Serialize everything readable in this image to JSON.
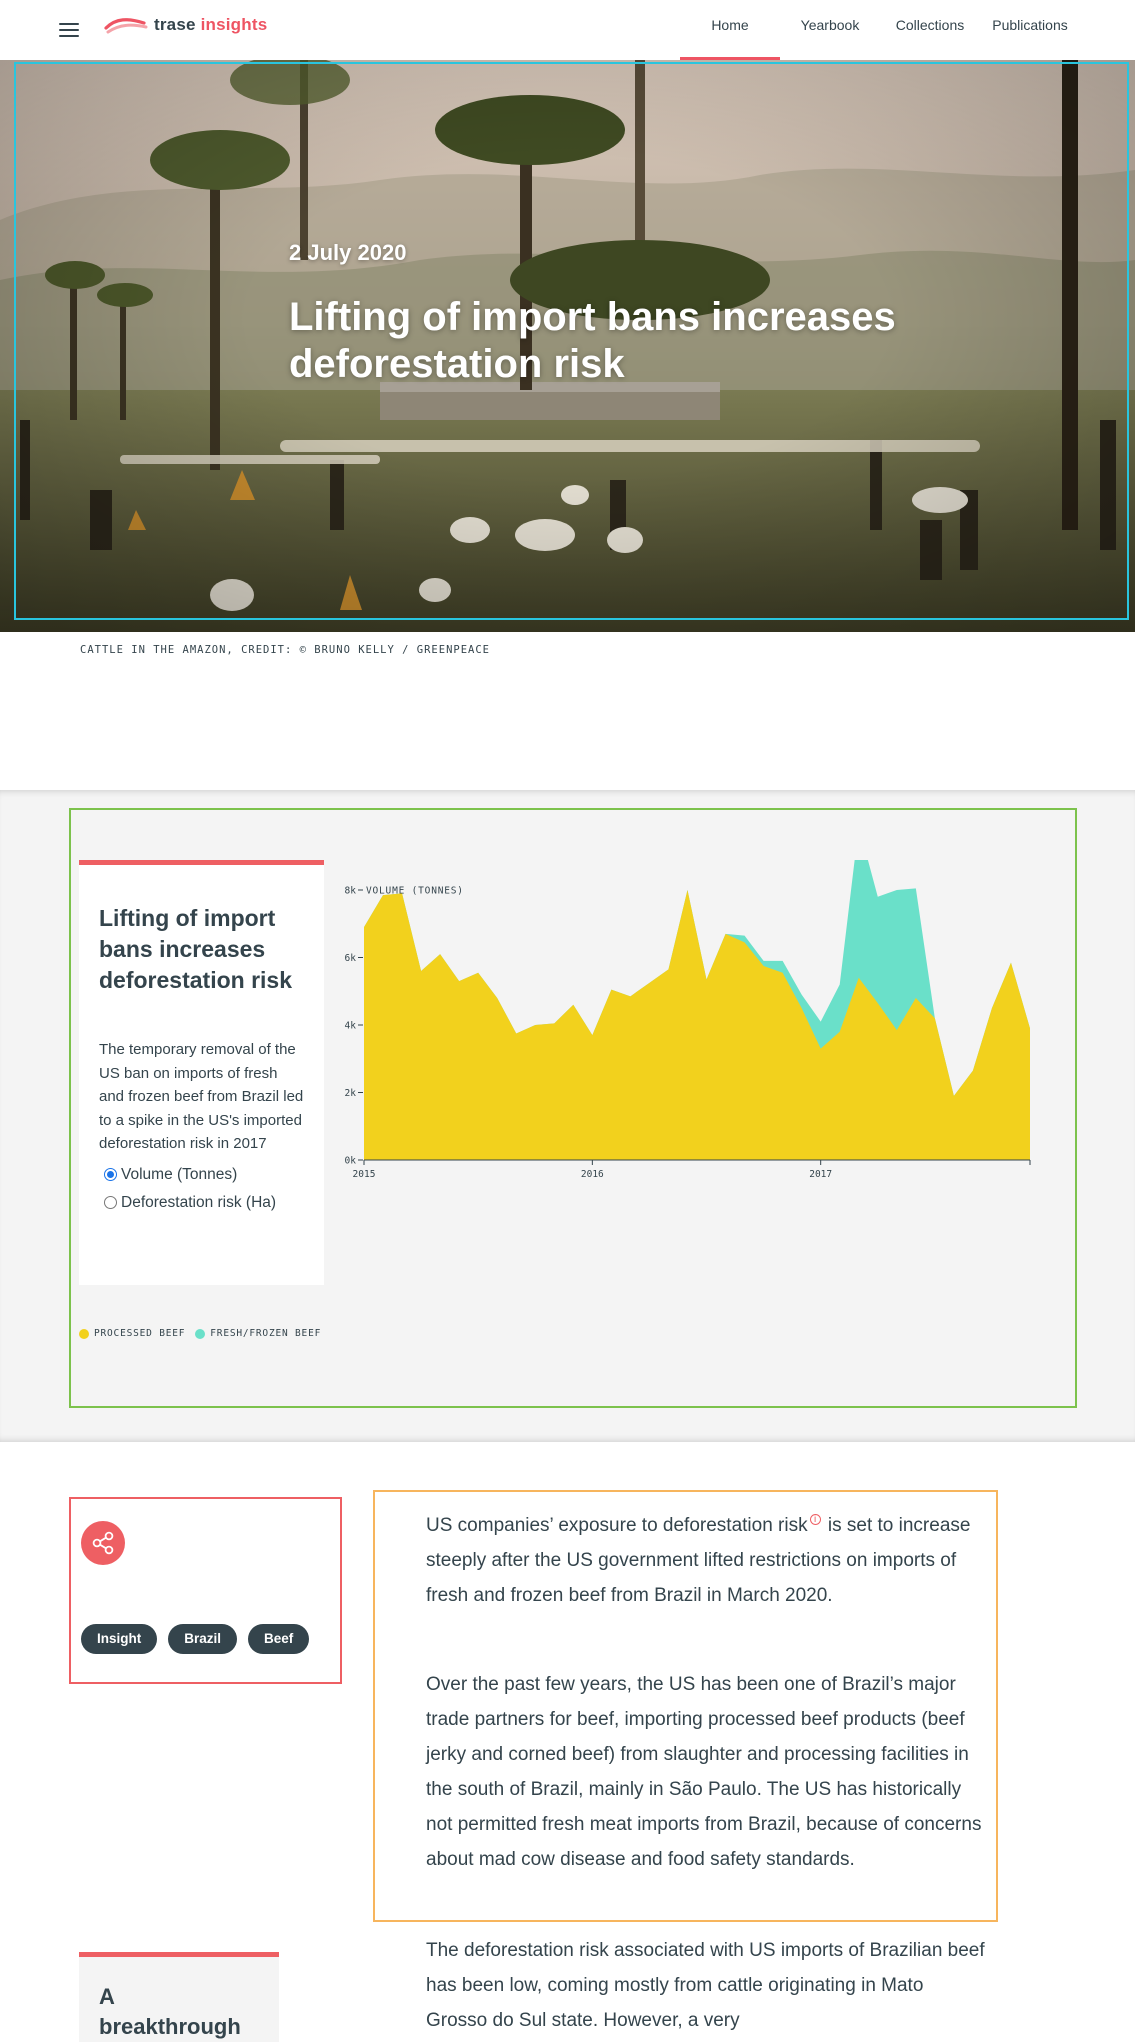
{
  "nav": {
    "logo_word1": "trase",
    "logo_word2": "insights",
    "links": [
      "Home",
      "Yearbook",
      "Collections",
      "Publications"
    ],
    "active": "Home"
  },
  "hero": {
    "date": "2 July 2020",
    "title": "Lifting of import bans increases deforestation risk",
    "caption": "CATTLE IN THE AMAZON, CREDIT: © BRUNO KELLY / GREENPEACE"
  },
  "chart_card": {
    "title": "Lifting of import bans increases deforestation risk",
    "description": "The temporary removal of the US ban on imports of fresh and frozen beef from Brazil led to a spike in the US's imported deforestation risk in 2017",
    "options": [
      "Volume (Tonnes)",
      "Deforestation risk (Ha)"
    ],
    "selected_option": "Volume (Tonnes)"
  },
  "chart_data": {
    "type": "area",
    "stacked": true,
    "ylabel": "VOLUME (TONNES)",
    "ylim": [
      0,
      8000
    ],
    "y_ticks": [
      0,
      2000,
      4000,
      6000,
      8000
    ],
    "y_tick_labels": [
      "0k",
      "2k",
      "4k",
      "6k",
      "8k"
    ],
    "x_tick_labels": [
      "2015",
      "2016",
      "2017"
    ],
    "x_ticks_at_month_index": [
      0,
      12,
      24
    ],
    "x_month_index": [
      0,
      1,
      2,
      3,
      4,
      5,
      6,
      7,
      8,
      9,
      10,
      11,
      12,
      13,
      14,
      15,
      16,
      17,
      18,
      19,
      20,
      21,
      22,
      23,
      24,
      25,
      26,
      27,
      28,
      29,
      30,
      31,
      32,
      33,
      34,
      35
    ],
    "series": [
      {
        "name": "PROCESSED BEEF",
        "color": "#f2d11d",
        "values": [
          6900,
          7850,
          7900,
          5600,
          6100,
          5300,
          5550,
          4800,
          3750,
          4000,
          4050,
          4600,
          3700,
          5050,
          4850,
          5250,
          5650,
          8000,
          5350,
          6700,
          6450,
          5750,
          5550,
          4500,
          3300,
          3800,
          5400,
          4650,
          3850,
          4800,
          4200,
          1900,
          2650,
          4500,
          5850,
          3900
        ]
      },
      {
        "name": "FRESH/FROZEN BEEF",
        "color": "#6ae0c9",
        "values": [
          0,
          0,
          0,
          0,
          0,
          0,
          0,
          0,
          0,
          0,
          0,
          0,
          0,
          0,
          0,
          0,
          0,
          0,
          0,
          0,
          200,
          150,
          350,
          400,
          800,
          1400,
          4500,
          3150,
          4150,
          3250,
          0,
          0,
          0,
          0,
          0,
          0
        ]
      }
    ],
    "legend_position": "bottom-left",
    "grid": false
  },
  "article": {
    "tags": [
      "Insight",
      "Brazil",
      "Beef"
    ],
    "p1_before": "US companies’ exposure to deforestation risk",
    "p1_after": " is set to increase steeply after the US government lifted restrictions on imports of fresh and frozen beef from Brazil in March 2020.",
    "p2": "Over the past few years, the US has been one of Brazil’s major trade partners for beef, importing processed beef products (beef jerky and corned beef) from slaughter and processing facilities in the south of Brazil, mainly in São Paulo. The US has historically not permitted fresh meat imports from Brazil, because of concerns about mad cow disease and food safety standards.",
    "p3": "The deforestation risk associated with US imports of Brazilian beef has been low, coming mostly from cattle originating in Mato Grosso do Sul state. However, a very",
    "related_title": "A breakthrough year"
  },
  "colors": {
    "accent": "#ee5f63",
    "dark": "#34444c",
    "processed": "#f2d11d",
    "fresh": "#6ae0c9"
  }
}
